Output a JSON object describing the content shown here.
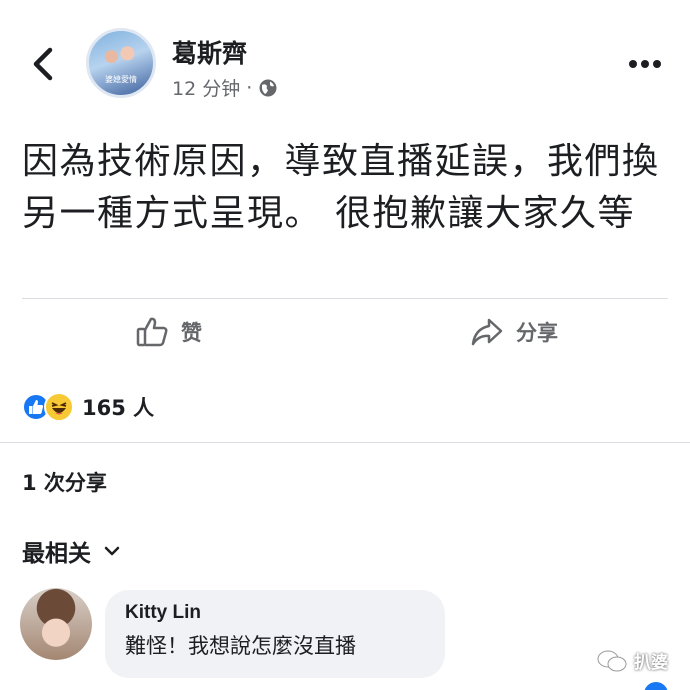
{
  "header": {
    "author_name": "葛斯齊",
    "timestamp": "12 分钟",
    "separator": "·",
    "avatar_poster_text": "婆媳愛情"
  },
  "post": {
    "text": "因為技術原因，導致直播延誤，我們換另一種方式呈現。 很抱歉讓大家久等"
  },
  "actions": {
    "like_label": "赞",
    "share_label": "分享"
  },
  "reactions": {
    "count": "165 人"
  },
  "shares": {
    "label": "1 次分享"
  },
  "comments": {
    "sort_label": "最相关",
    "items": [
      {
        "author": "Kitty Lin",
        "text": "難怪！我想說怎麼沒直播"
      }
    ]
  },
  "watermark": {
    "text": "扒婆"
  },
  "colors": {
    "accent": "#1877f2",
    "haha": "#f7c934",
    "secondary_text": "#65676b",
    "bubble": "#f0f2f5"
  }
}
